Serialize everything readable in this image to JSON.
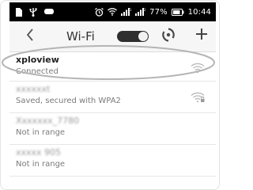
{
  "status_bar": {
    "battery_percent": "77%",
    "time": "10:44",
    "icons": [
      "sim-card-icon",
      "usb-icon",
      "message-icon",
      "alarm-icon",
      "wifi-signal-icon",
      "cellular-signal-1-icon",
      "cellular-signal-2-icon",
      "battery-icon"
    ]
  },
  "app_bar": {
    "title": "Wi-Fi",
    "wifi_toggle": "on",
    "icons": [
      "back-icon",
      "refresh-icon",
      "add-icon"
    ]
  },
  "networks": [
    {
      "name": "xploview",
      "status": "Connected",
      "highlighted": true,
      "obscured": false
    },
    {
      "name": "xxxxxxt",
      "status": "Saved, secured with WPA2",
      "highlighted": false,
      "obscured": true
    },
    {
      "name": "Xxxxxxx_7780",
      "status": "Not in range",
      "highlighted": false,
      "obscured": true
    },
    {
      "name": "xxxxx 905",
      "status": "Not in range",
      "highlighted": false,
      "obscured": true
    }
  ],
  "colors": {
    "status_bar_bg": "#000000",
    "app_bar_bg": "#f6f6f6",
    "toggle_on": "#2e2e2e",
    "highlight_outline": "#b5b5b5"
  }
}
